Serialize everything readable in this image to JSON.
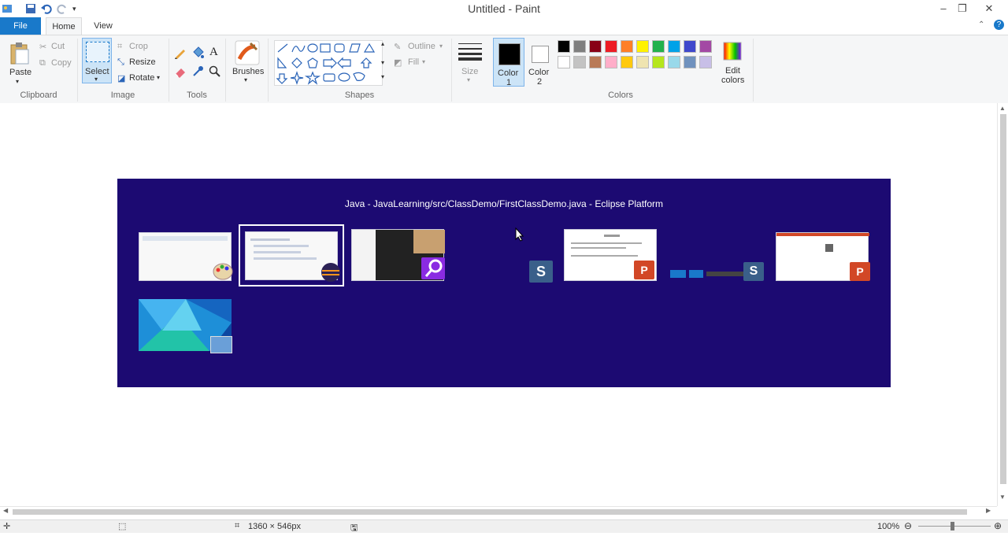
{
  "window": {
    "title": "Untitled - Paint"
  },
  "ribbon_tabs": {
    "file": "File",
    "home": "Home",
    "view": "View"
  },
  "clipboard": {
    "paste": "Paste",
    "cut": "Cut",
    "copy": "Copy",
    "label": "Clipboard"
  },
  "image_group": {
    "select": "Select",
    "crop": "Crop",
    "resize": "Resize",
    "rotate": "Rotate",
    "label": "Image"
  },
  "tools_group": {
    "label": "Tools",
    "brushes": "Brushes"
  },
  "shapes_group": {
    "outline": "Outline",
    "fill": "Fill",
    "label": "Shapes"
  },
  "size_group": {
    "size": "Size"
  },
  "colors_group": {
    "color1": "Color",
    "color1_num": "1",
    "color2": "Color",
    "color2_num": "2",
    "edit_colors_1": "Edit",
    "edit_colors_2": "colors",
    "label": "Colors",
    "color1_value": "#000000",
    "color2_value": "#ffffff",
    "palette_row1": [
      "#000000",
      "#7f7f7f",
      "#880015",
      "#ed1c24",
      "#ff7f27",
      "#fff200",
      "#22b14c",
      "#00a2e8",
      "#3f48cc",
      "#a349a4"
    ],
    "palette_row2": [
      "#ffffff",
      "#c3c3c3",
      "#b97a57",
      "#ffaec9",
      "#ffc90e",
      "#efe4b0",
      "#b5e61d",
      "#99d9ea",
      "#7092be",
      "#c8bfe7"
    ]
  },
  "canvas": {
    "switcher_title": "Java - JavaLearning/src/ClassDemo/FirstClassDemo.java - Eclipse Platform",
    "background": "#1c0a72"
  },
  "statusbar": {
    "dimensions": "1360 × 546px",
    "zoom": "100%"
  }
}
